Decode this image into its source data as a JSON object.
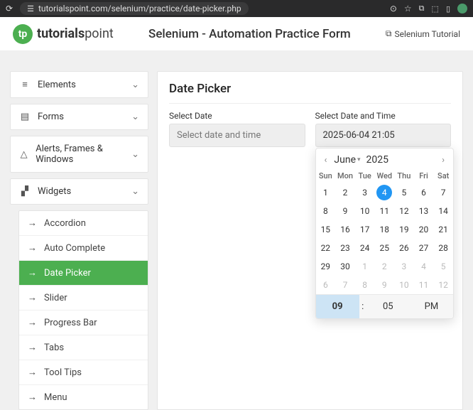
{
  "browser": {
    "url": "tutorialspoint.com/selenium/practice/date-picker.php"
  },
  "header": {
    "brand_bold": "tutorials",
    "brand_light": "point",
    "title": "Selenium - Automation Practice Form",
    "link": "Selenium Tutorial"
  },
  "sidebar": {
    "sections": [
      {
        "label": "Elements"
      },
      {
        "label": "Forms"
      },
      {
        "label": "Alerts, Frames & Windows"
      },
      {
        "label": "Widgets"
      }
    ],
    "widgets": [
      {
        "label": "Accordion"
      },
      {
        "label": "Auto Complete"
      },
      {
        "label": "Date Picker",
        "active": true
      },
      {
        "label": "Slider"
      },
      {
        "label": "Progress Bar"
      },
      {
        "label": "Tabs"
      },
      {
        "label": "Tool Tips"
      },
      {
        "label": "Menu"
      }
    ]
  },
  "main": {
    "heading": "Date Picker",
    "field1_label": "Select Date",
    "field1_placeholder": "Select date and time",
    "field2_label": "Select Date and Time",
    "field2_value": "2025-06-04 21:05"
  },
  "calendar": {
    "month": "June",
    "year": "2025",
    "dow": [
      "Sun",
      "Mon",
      "Tue",
      "Wed",
      "Thu",
      "Fri",
      "Sat"
    ],
    "rows": [
      [
        {
          "d": "1"
        },
        {
          "d": "2"
        },
        {
          "d": "3"
        },
        {
          "d": "4",
          "sel": true
        },
        {
          "d": "5"
        },
        {
          "d": "6"
        },
        {
          "d": "7"
        }
      ],
      [
        {
          "d": "8"
        },
        {
          "d": "9"
        },
        {
          "d": "10"
        },
        {
          "d": "11"
        },
        {
          "d": "12"
        },
        {
          "d": "13"
        },
        {
          "d": "14"
        }
      ],
      [
        {
          "d": "15"
        },
        {
          "d": "16"
        },
        {
          "d": "17"
        },
        {
          "d": "18"
        },
        {
          "d": "19"
        },
        {
          "d": "20"
        },
        {
          "d": "21"
        }
      ],
      [
        {
          "d": "22"
        },
        {
          "d": "23"
        },
        {
          "d": "24"
        },
        {
          "d": "25"
        },
        {
          "d": "26"
        },
        {
          "d": "27"
        },
        {
          "d": "28"
        }
      ],
      [
        {
          "d": "29"
        },
        {
          "d": "30"
        },
        {
          "d": "1",
          "out": true
        },
        {
          "d": "2",
          "out": true
        },
        {
          "d": "3",
          "out": true
        },
        {
          "d": "4",
          "out": true
        },
        {
          "d": "5",
          "out": true
        }
      ],
      [
        {
          "d": "6",
          "out": true
        },
        {
          "d": "7",
          "out": true
        },
        {
          "d": "8",
          "out": true
        },
        {
          "d": "9",
          "out": true
        },
        {
          "d": "10",
          "out": true
        },
        {
          "d": "11",
          "out": true
        },
        {
          "d": "12",
          "out": true
        }
      ]
    ],
    "time": {
      "hour": "09",
      "minute": "05",
      "ampm": "PM",
      "sep": ":"
    }
  }
}
